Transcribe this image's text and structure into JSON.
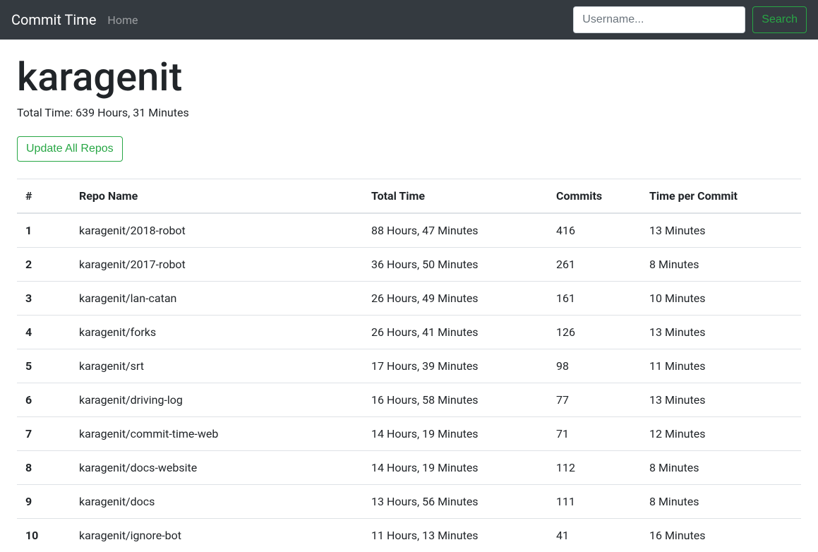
{
  "navbar": {
    "brand": "Commit Time",
    "home_link": "Home",
    "search_placeholder": "Username...",
    "search_button": "Search"
  },
  "page": {
    "title": "karagenit",
    "total_time_label": "Total Time: 639 Hours, 31 Minutes",
    "update_button": "Update All Repos"
  },
  "table": {
    "headers": {
      "num": "#",
      "repo": "Repo Name",
      "time": "Total Time",
      "commits": "Commits",
      "tpc": "Time per Commit"
    },
    "rows": [
      {
        "num": "1",
        "repo": "karagenit/2018-robot",
        "time": "88 Hours, 47 Minutes",
        "commits": "416",
        "tpc": "13 Minutes"
      },
      {
        "num": "2",
        "repo": "karagenit/2017-robot",
        "time": "36 Hours, 50 Minutes",
        "commits": "261",
        "tpc": "8 Minutes"
      },
      {
        "num": "3",
        "repo": "karagenit/lan-catan",
        "time": "26 Hours, 49 Minutes",
        "commits": "161",
        "tpc": "10 Minutes"
      },
      {
        "num": "4",
        "repo": "karagenit/forks",
        "time": "26 Hours, 41 Minutes",
        "commits": "126",
        "tpc": "13 Minutes"
      },
      {
        "num": "5",
        "repo": "karagenit/srt",
        "time": "17 Hours, 39 Minutes",
        "commits": "98",
        "tpc": "11 Minutes"
      },
      {
        "num": "6",
        "repo": "karagenit/driving-log",
        "time": "16 Hours, 58 Minutes",
        "commits": "77",
        "tpc": "13 Minutes"
      },
      {
        "num": "7",
        "repo": "karagenit/commit-time-web",
        "time": "14 Hours, 19 Minutes",
        "commits": "71",
        "tpc": "12 Minutes"
      },
      {
        "num": "8",
        "repo": "karagenit/docs-website",
        "time": "14 Hours, 19 Minutes",
        "commits": "112",
        "tpc": "8 Minutes"
      },
      {
        "num": "9",
        "repo": "karagenit/docs",
        "time": "13 Hours, 56 Minutes",
        "commits": "111",
        "tpc": "8 Minutes"
      },
      {
        "num": "10",
        "repo": "karagenit/ignore-bot",
        "time": "11 Hours, 13 Minutes",
        "commits": "41",
        "tpc": "16 Minutes"
      }
    ]
  }
}
